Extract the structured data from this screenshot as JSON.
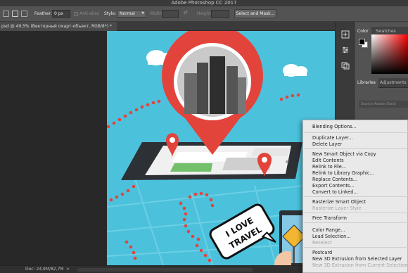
{
  "window": {
    "title": "Adobe Photoshop CC 2017"
  },
  "options_bar": {
    "feather_label": "Feather:",
    "feather_value": "0 px",
    "anti_alias_label": "Anti-alias",
    "style_label": "Style:",
    "style_value": "Normal",
    "width_label": "Width:",
    "height_label": "Height:",
    "select_mask_label": "Select and Mask..."
  },
  "document_tab": {
    "label": "psd @ 49,5% (Векторный смарт-объект, RGB/8*) *"
  },
  "status_bar": {
    "doc_size": "Doc: 24,9M/82,7M",
    "arrow": ">"
  },
  "panels": {
    "color_tab": "Color",
    "swatches_tab": "Swatches",
    "libraries_tab": "Libraries",
    "adjustments_tab": "Adjustments",
    "search_placeholder": "Search Adobe Stock"
  },
  "artwork": {
    "sign_text_1": "I LOVE",
    "sign_text_2": "TRAVEL"
  },
  "context_menu": {
    "items": [
      {
        "label": "Blending Options...",
        "enabled": true
      },
      {
        "label": "Duplicate Layer...",
        "enabled": true
      },
      {
        "label": "Delete Layer",
        "enabled": true
      },
      {
        "label": "New Smart Object via Copy",
        "enabled": true
      },
      {
        "label": "Edit Contents",
        "enabled": true
      },
      {
        "label": "Relink to File...",
        "enabled": true
      },
      {
        "label": "Relink to Library Graphic...",
        "enabled": true
      },
      {
        "label": "Replace Contents...",
        "enabled": true
      },
      {
        "label": "Export Contents...",
        "enabled": true
      },
      {
        "label": "Convert to Linked...",
        "enabled": true
      },
      {
        "label": "Rasterize Smart Object",
        "enabled": true
      },
      {
        "label": "Rasterize Layer Style",
        "enabled": false
      },
      {
        "label": "Free Transform",
        "enabled": true
      },
      {
        "label": "Color Range...",
        "enabled": true
      },
      {
        "label": "Load Selection...",
        "enabled": true
      },
      {
        "label": "Reselect",
        "enabled": false
      },
      {
        "label": "Postcard",
        "enabled": true
      },
      {
        "label": "New 3D Extrusion from Selected Layer",
        "enabled": true
      },
      {
        "label": "New 3D Extrusion from Current Selection",
        "enabled": false
      }
    ]
  },
  "colors": {
    "canvas_bg": "#4cc1dc",
    "pin_red": "#e2443c",
    "menu_bg": "#e9e9e9"
  }
}
